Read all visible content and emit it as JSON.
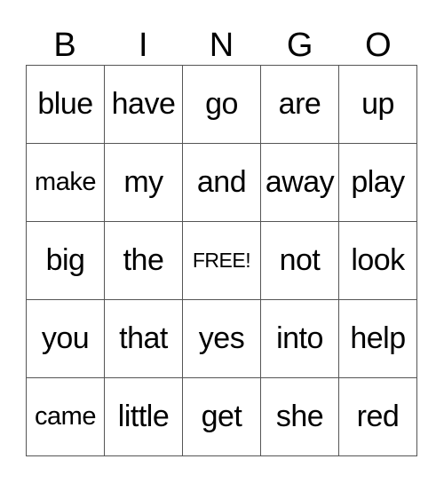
{
  "card": {
    "header": [
      "B",
      "I",
      "N",
      "G",
      "O"
    ],
    "rows": [
      [
        "blue",
        "have",
        "go",
        "are",
        "up"
      ],
      [
        "make",
        "my",
        "and",
        "away",
        "play"
      ],
      [
        "big",
        "the",
        "FREE!",
        "not",
        "look"
      ],
      [
        "you",
        "that",
        "yes",
        "into",
        "help"
      ],
      [
        "came",
        "little",
        "get",
        "she",
        "red"
      ]
    ],
    "free_space": "FREE!",
    "colors": {
      "background": "#ffffff",
      "text": "#000000",
      "grid_lines": "#555555"
    }
  }
}
